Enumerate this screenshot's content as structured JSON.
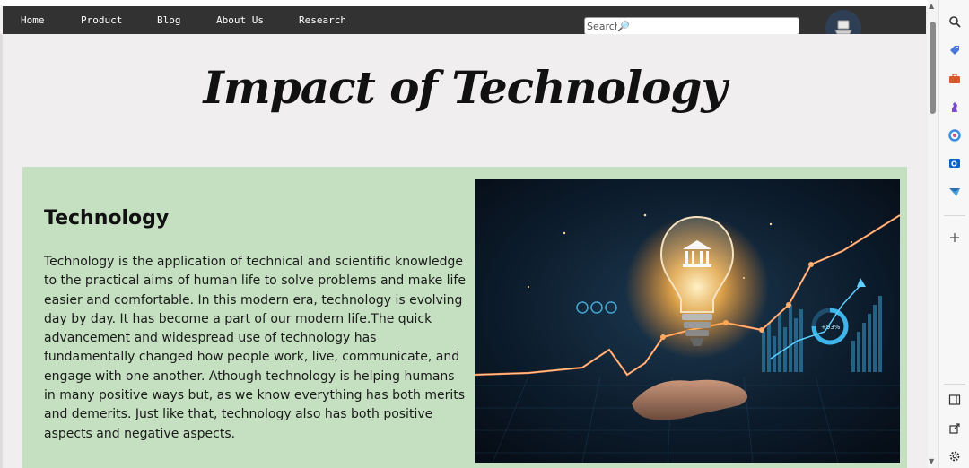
{
  "nav": {
    "links": [
      "Home",
      "Product",
      "Blog",
      "About Us",
      "Research"
    ],
    "search_placeholder": "Search"
  },
  "header": {
    "title": "Impact of Technology"
  },
  "section": {
    "heading": "Technology",
    "paragraph": "Technology is the application of technical and scientific knowledge to the practical aims of human life to solve problems and make life easier and comfortable. In this modern era, technology is evolving day by day. It has become a part of our modern life.The quick advancement and widespread use of technology has fundamentally changed how people work, live, communicate, and engage with one another. Athough technology is helping humans in many positive ways but, as we know everything has both merits and demerits. Just like that, technology also has both positive aspects and negative aspects.",
    "image_percent_label": "+93%"
  },
  "colors": {
    "navbar": "#323232",
    "header_bg": "#f0eeee",
    "content_bg": "#c4e0c0"
  },
  "sidebar_icons": [
    "search-icon",
    "tag-icon",
    "briefcase-icon",
    "chess-icon",
    "office-icon",
    "outlook-icon",
    "send-icon",
    "add-icon",
    "split-screen-icon",
    "external-link-icon",
    "settings-icon"
  ]
}
